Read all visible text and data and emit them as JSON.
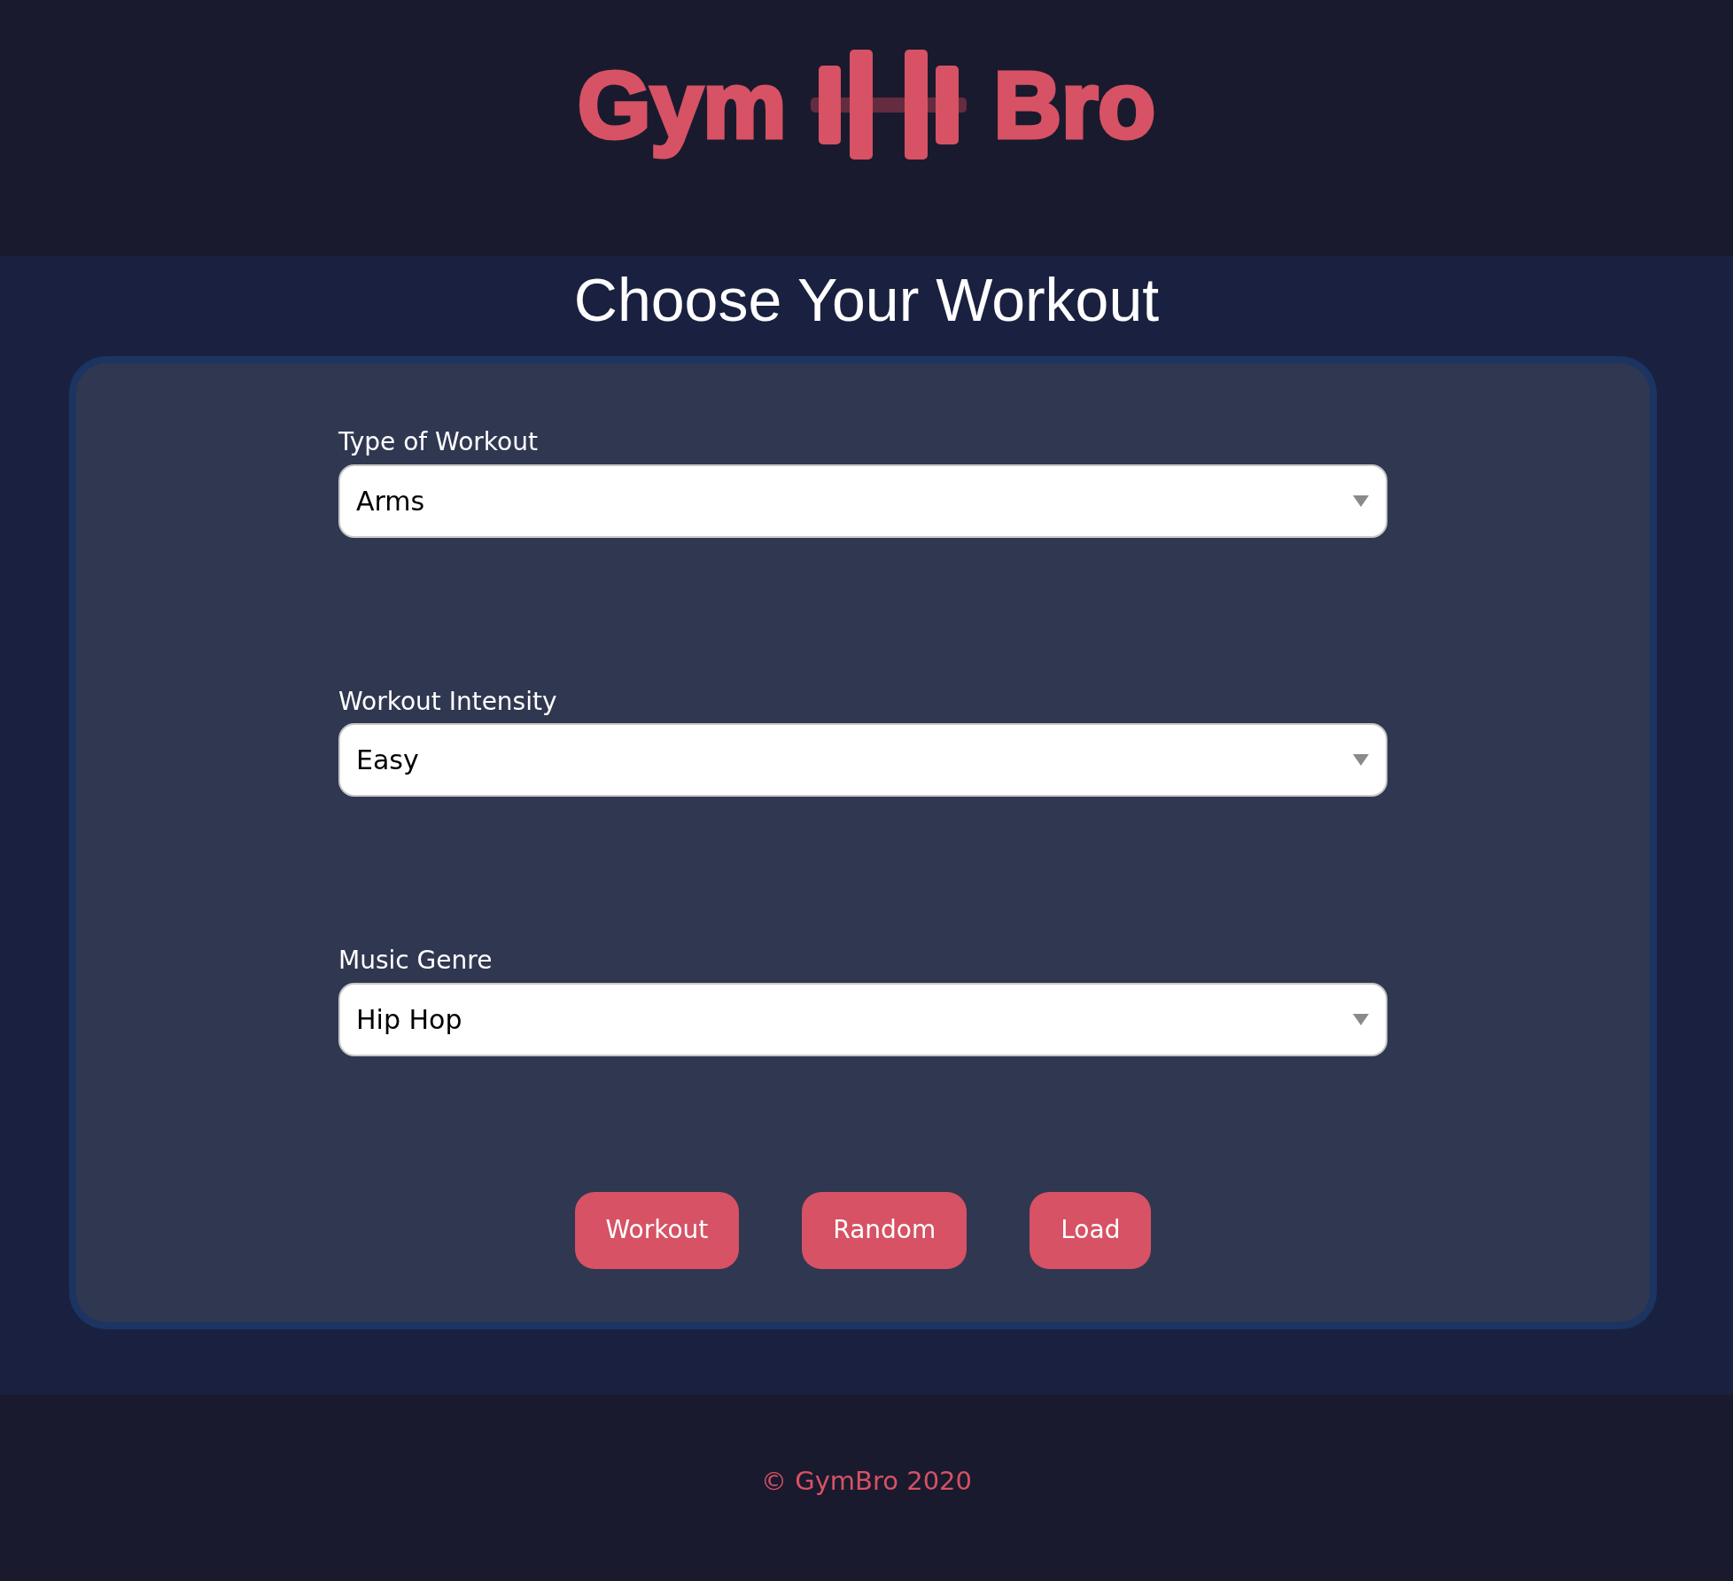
{
  "header": {
    "logo": {
      "left_text": "Gym",
      "right_text": "Bro"
    }
  },
  "main": {
    "title": "Choose Your Workout",
    "fields": [
      {
        "label": "Type of Workout",
        "value": "Arms"
      },
      {
        "label": "Workout Intensity",
        "value": "Easy"
      },
      {
        "label": "Music Genre",
        "value": "Hip Hop"
      }
    ],
    "buttons": [
      "Workout",
      "Random",
      "Load"
    ]
  },
  "footer": {
    "copyright": "© GymBro 2020"
  }
}
